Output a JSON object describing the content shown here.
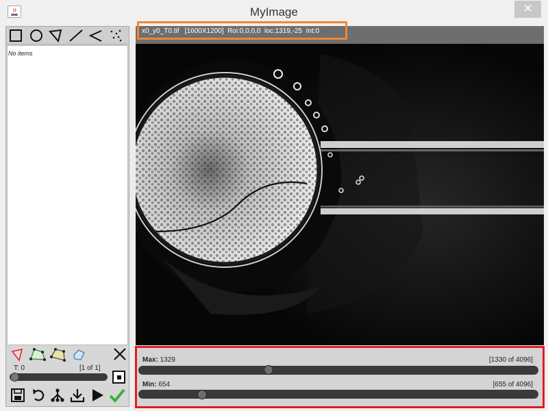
{
  "window": {
    "title": "MyImage",
    "close_label": "✕",
    "app_icon": "java-app-icon"
  },
  "roi_panel": {
    "shape_tools": [
      "rectangle-tool-icon",
      "ellipse-tool-icon",
      "polygon-tool-icon",
      "line-tool-icon",
      "polyline-tool-icon",
      "point-tool-icon"
    ],
    "list_empty_text": "No items"
  },
  "roi_tools": {
    "action_icons": [
      "roi-red-icon",
      "roi-green-polygon-icon",
      "roi-yellow-polygon-icon",
      "roi-blue-icon",
      "close-x-icon"
    ],
    "time_label": "T: 0",
    "frame_count": "[1 of 1]",
    "time_position": 0,
    "bottom_icons": [
      "save-icon",
      "undo-icon",
      "tree-icon",
      "download-icon",
      "play-icon",
      "checkmark-icon"
    ]
  },
  "image": {
    "info_text": "x0_y0_T0.tif   [1600X1200]  Roi:0,0,0,0  loc:1319,-25  Int:0"
  },
  "contrast": {
    "max_label": "Max:",
    "max_value": "1329",
    "max_range_text": "[1330 of 4096]",
    "max_fraction": 0.3247,
    "min_label": "Min:",
    "min_value": "654",
    "min_range_text": "[655 of 4096]",
    "min_fraction": 0.16
  },
  "colors": {
    "info_highlight": "#f5852f",
    "contrast_highlight": "#e01b24",
    "image_background": "#050505"
  }
}
